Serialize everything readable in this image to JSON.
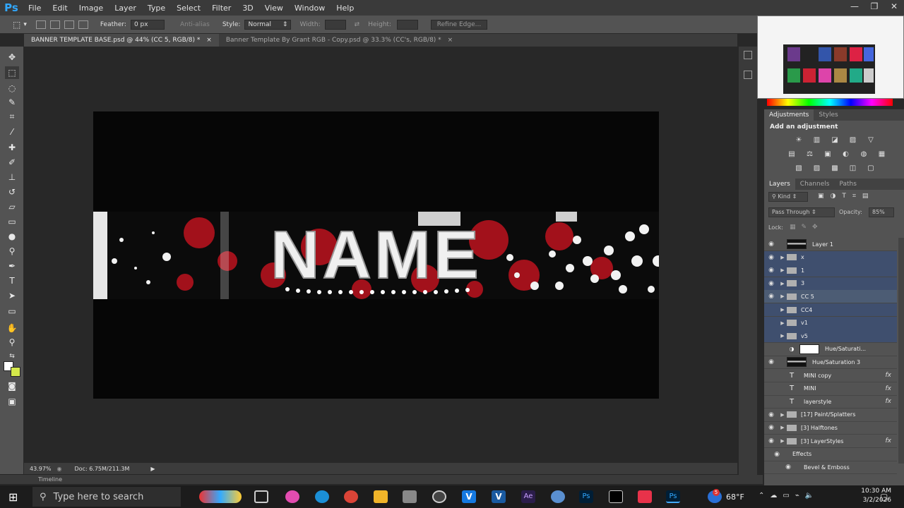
{
  "app": {
    "logo": "Ps"
  },
  "menu": [
    "File",
    "Edit",
    "Image",
    "Layer",
    "Type",
    "Select",
    "Filter",
    "3D",
    "View",
    "Window",
    "Help"
  ],
  "window_controls": [
    "minimize-icon",
    "restore-icon",
    "close-icon"
  ],
  "options_bar": {
    "feather_label": "Feather:",
    "feather_value": "0 px",
    "antialias_label": "Anti-alias",
    "style_label": "Style:",
    "style_value": "Normal",
    "width_label": "Width:",
    "height_label": "Height:",
    "refine_edge": "Refine Edge..."
  },
  "doc_tabs": [
    {
      "label": "BANNER TEMPLATE BASE.psd @ 44% (CC 5, RGB/8) *",
      "close": "×"
    },
    {
      "label": "Banner Template By Grant RGB - Copy.psd @ 33.3% (CC's, RGB/8) *",
      "close": "×"
    }
  ],
  "canvas": {
    "banner_text": "NAME"
  },
  "status": {
    "zoom": "43.97%",
    "doc": "Doc: 6.75M/211.3M"
  },
  "timeline_label": "Timeline",
  "adjustments": {
    "tabs": [
      "Adjustments",
      "Styles"
    ],
    "heading": "Add an adjustment",
    "row1": [
      "☀",
      "▥",
      "◪",
      "▨",
      "▽"
    ],
    "row2": [
      "▤",
      "⚖",
      "▣",
      "◐",
      "◍",
      "▦"
    ],
    "row3": [
      "▧",
      "▨",
      "▩",
      "◫",
      "▢"
    ]
  },
  "layers": {
    "tabs": [
      "Layers",
      "Channels",
      "Paths"
    ],
    "kind": "Kind",
    "blend_mode": "Pass Through",
    "opacity_label": "Opacity:",
    "opacity_value": "85%",
    "lock_label": "Lock:",
    "items": [
      {
        "name": "Layer 1",
        "type": "pixel",
        "visible": true
      },
      {
        "name": "x",
        "type": "group",
        "visible": true
      },
      {
        "name": "1",
        "type": "group",
        "visible": true
      },
      {
        "name": "3",
        "type": "group",
        "visible": true
      },
      {
        "name": "CC 5",
        "type": "group",
        "visible": true,
        "selected": true
      },
      {
        "name": "CC4",
        "type": "group",
        "visible": false
      },
      {
        "name": "v1",
        "type": "group",
        "visible": false
      },
      {
        "name": "v5",
        "type": "group",
        "visible": false
      },
      {
        "name": "Hue/Saturati...",
        "type": "adjustment",
        "visible": false
      },
      {
        "name": "Hue/Saturation 3",
        "type": "pixel",
        "visible": true
      },
      {
        "name": "MINI copy",
        "type": "text",
        "visible": false,
        "fx": "fx"
      },
      {
        "name": "MINI",
        "type": "text",
        "visible": false,
        "fx": "fx"
      },
      {
        "name": "layerstyle",
        "type": "text",
        "visible": false,
        "fx": "fx"
      },
      {
        "name": "[17] Paint/Splatters",
        "type": "group",
        "visible": true
      },
      {
        "name": "[3] Halftones",
        "type": "group",
        "visible": true
      },
      {
        "name": "[3] LayerStyles",
        "type": "group",
        "visible": true,
        "fx": "fx"
      },
      {
        "name": "Effects",
        "type": "effects",
        "visible": true
      },
      {
        "name": "Bevel & Emboss",
        "type": "effect",
        "visible": true
      }
    ]
  },
  "taskbar": {
    "search_placeholder": "Type here to search",
    "weather": "68°F",
    "notification_badge": "5",
    "time": "10:30 AM",
    "date": "3/2/2026"
  },
  "colors": {
    "accent": "#31a8ff",
    "selection": "#4c5c74",
    "splatter_red": "#b3121d"
  }
}
